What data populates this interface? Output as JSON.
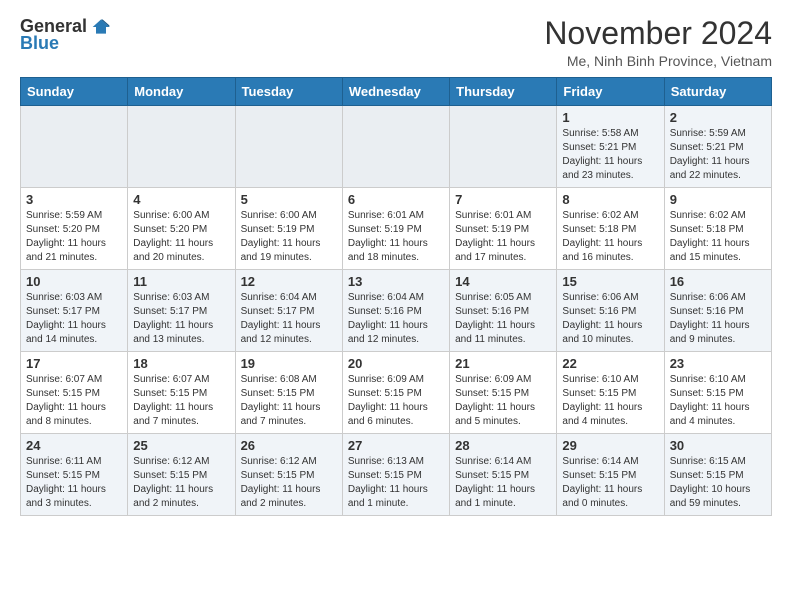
{
  "logo": {
    "general": "General",
    "blue": "Blue"
  },
  "title": "November 2024",
  "location": "Me, Ninh Binh Province, Vietnam",
  "weekdays": [
    "Sunday",
    "Monday",
    "Tuesday",
    "Wednesday",
    "Thursday",
    "Friday",
    "Saturday"
  ],
  "weeks": [
    [
      {
        "day": "",
        "info": ""
      },
      {
        "day": "",
        "info": ""
      },
      {
        "day": "",
        "info": ""
      },
      {
        "day": "",
        "info": ""
      },
      {
        "day": "",
        "info": ""
      },
      {
        "day": "1",
        "info": "Sunrise: 5:58 AM\nSunset: 5:21 PM\nDaylight: 11 hours\nand 23 minutes."
      },
      {
        "day": "2",
        "info": "Sunrise: 5:59 AM\nSunset: 5:21 PM\nDaylight: 11 hours\nand 22 minutes."
      }
    ],
    [
      {
        "day": "3",
        "info": "Sunrise: 5:59 AM\nSunset: 5:20 PM\nDaylight: 11 hours\nand 21 minutes."
      },
      {
        "day": "4",
        "info": "Sunrise: 6:00 AM\nSunset: 5:20 PM\nDaylight: 11 hours\nand 20 minutes."
      },
      {
        "day": "5",
        "info": "Sunrise: 6:00 AM\nSunset: 5:19 PM\nDaylight: 11 hours\nand 19 minutes."
      },
      {
        "day": "6",
        "info": "Sunrise: 6:01 AM\nSunset: 5:19 PM\nDaylight: 11 hours\nand 18 minutes."
      },
      {
        "day": "7",
        "info": "Sunrise: 6:01 AM\nSunset: 5:19 PM\nDaylight: 11 hours\nand 17 minutes."
      },
      {
        "day": "8",
        "info": "Sunrise: 6:02 AM\nSunset: 5:18 PM\nDaylight: 11 hours\nand 16 minutes."
      },
      {
        "day": "9",
        "info": "Sunrise: 6:02 AM\nSunset: 5:18 PM\nDaylight: 11 hours\nand 15 minutes."
      }
    ],
    [
      {
        "day": "10",
        "info": "Sunrise: 6:03 AM\nSunset: 5:17 PM\nDaylight: 11 hours\nand 14 minutes."
      },
      {
        "day": "11",
        "info": "Sunrise: 6:03 AM\nSunset: 5:17 PM\nDaylight: 11 hours\nand 13 minutes."
      },
      {
        "day": "12",
        "info": "Sunrise: 6:04 AM\nSunset: 5:17 PM\nDaylight: 11 hours\nand 12 minutes."
      },
      {
        "day": "13",
        "info": "Sunrise: 6:04 AM\nSunset: 5:16 PM\nDaylight: 11 hours\nand 12 minutes."
      },
      {
        "day": "14",
        "info": "Sunrise: 6:05 AM\nSunset: 5:16 PM\nDaylight: 11 hours\nand 11 minutes."
      },
      {
        "day": "15",
        "info": "Sunrise: 6:06 AM\nSunset: 5:16 PM\nDaylight: 11 hours\nand 10 minutes."
      },
      {
        "day": "16",
        "info": "Sunrise: 6:06 AM\nSunset: 5:16 PM\nDaylight: 11 hours\nand 9 minutes."
      }
    ],
    [
      {
        "day": "17",
        "info": "Sunrise: 6:07 AM\nSunset: 5:15 PM\nDaylight: 11 hours\nand 8 minutes."
      },
      {
        "day": "18",
        "info": "Sunrise: 6:07 AM\nSunset: 5:15 PM\nDaylight: 11 hours\nand 7 minutes."
      },
      {
        "day": "19",
        "info": "Sunrise: 6:08 AM\nSunset: 5:15 PM\nDaylight: 11 hours\nand 7 minutes."
      },
      {
        "day": "20",
        "info": "Sunrise: 6:09 AM\nSunset: 5:15 PM\nDaylight: 11 hours\nand 6 minutes."
      },
      {
        "day": "21",
        "info": "Sunrise: 6:09 AM\nSunset: 5:15 PM\nDaylight: 11 hours\nand 5 minutes."
      },
      {
        "day": "22",
        "info": "Sunrise: 6:10 AM\nSunset: 5:15 PM\nDaylight: 11 hours\nand 4 minutes."
      },
      {
        "day": "23",
        "info": "Sunrise: 6:10 AM\nSunset: 5:15 PM\nDaylight: 11 hours\nand 4 minutes."
      }
    ],
    [
      {
        "day": "24",
        "info": "Sunrise: 6:11 AM\nSunset: 5:15 PM\nDaylight: 11 hours\nand 3 minutes."
      },
      {
        "day": "25",
        "info": "Sunrise: 6:12 AM\nSunset: 5:15 PM\nDaylight: 11 hours\nand 2 minutes."
      },
      {
        "day": "26",
        "info": "Sunrise: 6:12 AM\nSunset: 5:15 PM\nDaylight: 11 hours\nand 2 minutes."
      },
      {
        "day": "27",
        "info": "Sunrise: 6:13 AM\nSunset: 5:15 PM\nDaylight: 11 hours\nand 1 minute."
      },
      {
        "day": "28",
        "info": "Sunrise: 6:14 AM\nSunset: 5:15 PM\nDaylight: 11 hours\nand 1 minute."
      },
      {
        "day": "29",
        "info": "Sunrise: 6:14 AM\nSunset: 5:15 PM\nDaylight: 11 hours\nand 0 minutes."
      },
      {
        "day": "30",
        "info": "Sunrise: 6:15 AM\nSunset: 5:15 PM\nDaylight: 10 hours\nand 59 minutes."
      }
    ]
  ]
}
